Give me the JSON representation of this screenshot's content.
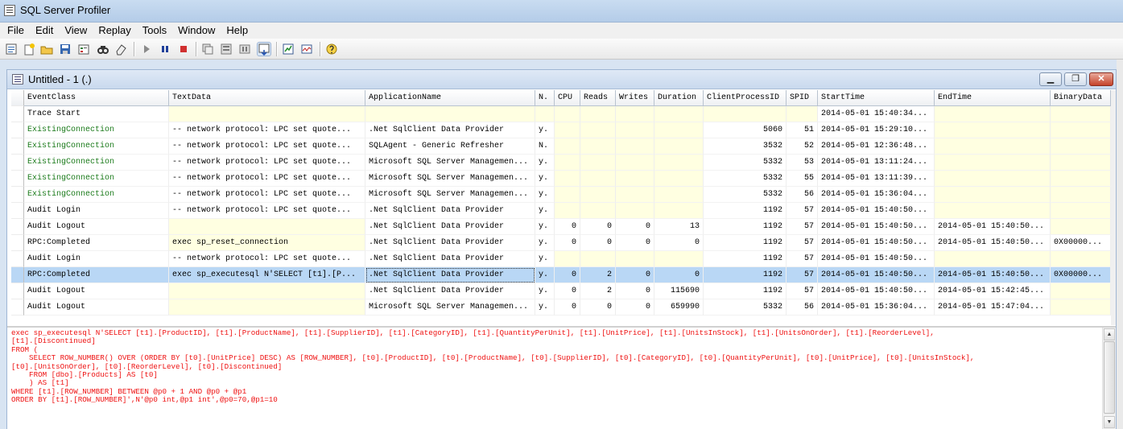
{
  "app": {
    "title": "SQL Server Profiler"
  },
  "menu": [
    "File",
    "Edit",
    "View",
    "Replay",
    "Tools",
    "Window",
    "Help"
  ],
  "toolbar": {
    "icons": [
      "new-trace-icon",
      "new-template-icon",
      "open-icon",
      "save-icon",
      "properties-icon",
      "find-icon",
      "clear-icon",
      "start-icon",
      "pause-icon",
      "stop-icon",
      "auto-scroll-icon",
      "properties-grid-icon",
      "column-filter-icon",
      "scroll-lock-icon",
      "performance-monitor-icon",
      "activity-monitor-icon",
      "help-icon"
    ]
  },
  "document": {
    "title": "Untitled - 1 (.)",
    "controls": {
      "minimize": "▁",
      "restore": "❐",
      "close": "✕"
    }
  },
  "grid": {
    "columns": [
      "EventClass",
      "TextData",
      "ApplicationName",
      "N.",
      "CPU",
      "Reads",
      "Writes",
      "Duration",
      "ClientProcessID",
      "SPID",
      "StartTime",
      "EndTime",
      "BinaryData"
    ],
    "rows": [
      [
        "Trace Start",
        "",
        "",
        "",
        "",
        "",
        "",
        "",
        "",
        "",
        "2014-05-01 15:40:34...",
        "",
        ""
      ],
      [
        "ExistingConnection",
        "-- network protocol: LPC  set quote...",
        ".Net SqlClient Data Provider",
        "y.",
        "",
        "",
        "",
        "",
        "5060",
        "51",
        "2014-05-01 15:29:10...",
        "",
        ""
      ],
      [
        "ExistingConnection",
        "-- network protocol: LPC  set quote...",
        "SQLAgent - Generic Refresher",
        "N.",
        "",
        "",
        "",
        "",
        "3532",
        "52",
        "2014-05-01 12:36:48...",
        "",
        ""
      ],
      [
        "ExistingConnection",
        "-- network protocol: LPC  set quote...",
        "Microsoft SQL Server Managemen...",
        "y.",
        "",
        "",
        "",
        "",
        "5332",
        "53",
        "2014-05-01 13:11:24...",
        "",
        ""
      ],
      [
        "ExistingConnection",
        "-- network protocol: LPC  set quote...",
        "Microsoft SQL Server Managemen...",
        "y.",
        "",
        "",
        "",
        "",
        "5332",
        "55",
        "2014-05-01 13:11:39...",
        "",
        ""
      ],
      [
        "ExistingConnection",
        "-- network protocol: LPC  set quote...",
        "Microsoft SQL Server Managemen...",
        "y.",
        "",
        "",
        "",
        "",
        "5332",
        "56",
        "2014-05-01 15:36:04...",
        "",
        ""
      ],
      [
        "Audit Login",
        "-- network protocol: LPC  set quote...",
        ".Net SqlClient Data Provider",
        "y.",
        "",
        "",
        "",
        "",
        "1192",
        "57",
        "2014-05-01 15:40:50...",
        "",
        ""
      ],
      [
        "Audit Logout",
        "",
        ".Net SqlClient Data Provider",
        "y.",
        "0",
        "0",
        "0",
        "13",
        "1192",
        "57",
        "2014-05-01 15:40:50...",
        "2014-05-01 15:40:50...",
        ""
      ],
      [
        "RPC:Completed",
        "exec sp_reset_connection",
        ".Net SqlClient Data Provider",
        "y.",
        "0",
        "0",
        "0",
        "0",
        "1192",
        "57",
        "2014-05-01 15:40:50...",
        "2014-05-01 15:40:50...",
        "0X00000..."
      ],
      [
        "Audit Login",
        "-- network protocol: LPC  set quote...",
        ".Net SqlClient Data Provider",
        "y.",
        "",
        "",
        "",
        "",
        "1192",
        "57",
        "2014-05-01 15:40:50...",
        "",
        ""
      ],
      [
        "RPC:Completed",
        "exec sp_executesql N'SELECT [t1].[P...",
        ".Net SqlClient Data Provider",
        "y.",
        "0",
        "2",
        "0",
        "0",
        "1192",
        "57",
        "2014-05-01 15:40:50...",
        "2014-05-01 15:40:50...",
        "0X00000..."
      ],
      [
        "Audit Logout",
        "",
        ".Net SqlClient Data Provider",
        "y.",
        "0",
        "2",
        "0",
        "115690",
        "1192",
        "57",
        "2014-05-01 15:40:50...",
        "2014-05-01 15:42:45...",
        ""
      ],
      [
        "Audit Logout",
        "",
        "Microsoft SQL Server Managemen...",
        "y.",
        "0",
        "0",
        "0",
        "659990",
        "5332",
        "56",
        "2014-05-01 15:36:04...",
        "2014-05-01 15:47:04...",
        ""
      ]
    ],
    "selected_row": 10,
    "event_colors": {
      "ExistingConnection": "#1a7a1a"
    }
  },
  "textdata": {
    "color": "#ee1111",
    "lines": [
      "exec sp_executesql N'SELECT [t1].[ProductID], [t1].[ProductName], [t1].[SupplierID], [t1].[CategoryID], [t1].[QuantityPerUnit], [t1].[UnitPrice], [t1].[UnitsInStock], [t1].[UnitsOnOrder], [t1].[ReorderLevel],",
      "[t1].[Discontinued]",
      "FROM (",
      "    SELECT ROW_NUMBER() OVER (ORDER BY [t0].[UnitPrice] DESC) AS [ROW_NUMBER], [t0].[ProductID], [t0].[ProductName], [t0].[SupplierID], [t0].[CategoryID], [t0].[QuantityPerUnit], [t0].[UnitPrice], [t0].[UnitsInStock],",
      "[t0].[UnitsOnOrder], [t0].[ReorderLevel], [t0].[Discontinued]",
      "    FROM [dbo].[Products] AS [t0]",
      "    ) AS [t1]",
      "WHERE [t1].[ROW_NUMBER] BETWEEN @p0 + 1 AND @p0 + @p1",
      "ORDER BY [t1].[ROW_NUMBER]',N'@p0 int,@p1 int',@p0=70,@p1=10"
    ]
  }
}
